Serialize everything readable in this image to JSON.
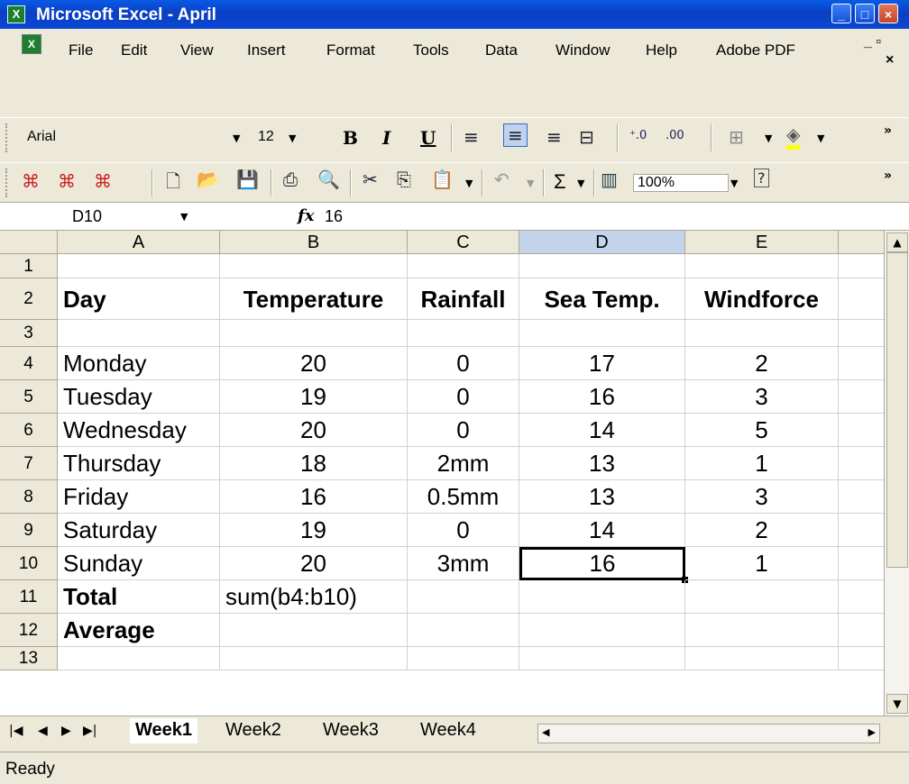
{
  "window": {
    "title": "Microsoft Excel - April",
    "app_icon": "excel-icon"
  },
  "menu": [
    "File",
    "Edit",
    "View",
    "Insert",
    "Format",
    "Tools",
    "Data",
    "Window",
    "Help",
    "Adobe PDF"
  ],
  "formatting_toolbar": {
    "font": "Arial",
    "size": "12",
    "bold": "B",
    "italic": "I",
    "underline": "U",
    "decimals_inc": "+.0\n.00",
    "decimals_dec": ".00\n+.0"
  },
  "standard_toolbar": {
    "sigma": "Σ",
    "zoom": "100%"
  },
  "formula_bar": {
    "name_box": "D10",
    "fx": "fx",
    "value": "16"
  },
  "columns": [
    "A",
    "B",
    "C",
    "D",
    "E"
  ],
  "rows": [
    "1",
    "2",
    "3",
    "4",
    "5",
    "6",
    "7",
    "8",
    "9",
    "10",
    "11",
    "12",
    "13"
  ],
  "cells": {
    "r2": [
      "Day",
      "Temperature",
      "Rainfall",
      "Sea Temp.",
      "Windforce"
    ],
    "data": [
      [
        "Monday",
        "20",
        "0",
        "17",
        "2"
      ],
      [
        "Tuesday",
        "19",
        "0",
        "16",
        "3"
      ],
      [
        "Wednesday",
        "20",
        "0",
        "14",
        "5"
      ],
      [
        "Thursday",
        "18",
        "2mm",
        "13",
        "1"
      ],
      [
        "Friday",
        "16",
        "0.5mm",
        "13",
        "3"
      ],
      [
        "Saturday",
        "19",
        "0",
        "14",
        "2"
      ],
      [
        "Sunday",
        "20",
        "3mm",
        "16",
        "1"
      ]
    ],
    "r11": [
      "Total",
      "sum(b4:b10)"
    ],
    "r12": [
      "Average"
    ]
  },
  "sheets": [
    "Week1",
    "Week2",
    "Week3",
    "Week4"
  ],
  "status": "Ready"
}
